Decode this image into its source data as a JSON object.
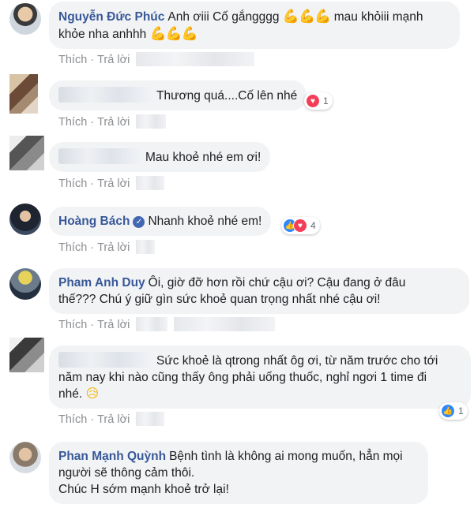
{
  "actions": {
    "like": "Thích",
    "reply": "Trả lời",
    "separator": "·"
  },
  "comments": [
    {
      "name": "Nguyễn Đức Phúc",
      "text1": "Anh ơiii Cố gắngggg",
      "text2": "mau khỏiii mạnh",
      "text3": "khỏe nha anhhh",
      "avatar": "avatar-photo"
    },
    {
      "name": "",
      "text": "Thương quá....Cố lên nhé",
      "reaction_count": "1",
      "avatar": "avatar-pixelated"
    },
    {
      "name": "",
      "text": "Mau khoẻ nhé em ơi!",
      "avatar": "avatar-pixelated"
    },
    {
      "name": "Hoàng Bách",
      "text": "Nhanh khoẻ nhé em!",
      "reaction_count": "4",
      "avatar": "avatar-photo",
      "verified": true
    },
    {
      "name": "Pham Anh Duy",
      "text1": "Ôi, giờ đỡ hơn rồi chứ cậu ơi? Cậu đang ở đâu",
      "text2": "thế??? Chú ý giữ gìn sức khoẻ quan trọng nhất nhé cậu ơi!",
      "avatar": "avatar-photo"
    },
    {
      "name": "",
      "text1": "Sức khoẻ là qtrong nhất ôg ơi, từ năm trước cho tới",
      "text2": "năm nay khi nào cũng thấy ông phải uống thuốc, nghỉ ngơi 1 time đi",
      "text3": "nhé.",
      "reaction_count": "1",
      "avatar": "avatar-pixelated"
    },
    {
      "name": "Phan Mạnh Quỳnh",
      "text1": "Bệnh tình là không ai mong muốn, hẳn mọi",
      "text2": "người sẽ thông cảm thôi.",
      "text3": "Chúc H sớm mạnh khoẻ trở lại!",
      "avatar": "avatar-photo"
    }
  ],
  "colors": {
    "name_link": "#385898",
    "bubble_bg": "#f2f3f5",
    "like_blue": "#2d88ff",
    "heart_red": "#f33e58",
    "meta_gray": "#8a8d91"
  }
}
